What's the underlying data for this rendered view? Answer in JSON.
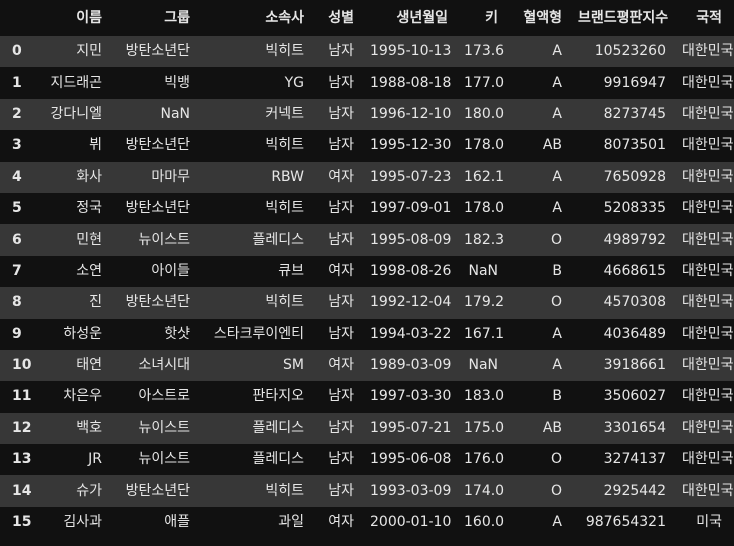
{
  "table": {
    "columns": [
      "",
      "이름",
      "그룹",
      "소속사",
      "성별",
      "생년월일",
      "키",
      "혈액형",
      "브랜드평판지수",
      "국적"
    ],
    "rows": [
      [
        "0",
        "지민",
        "방탄소년단",
        "빅히트",
        "남자",
        "1995-10-13",
        "173.6",
        "A",
        "10523260",
        "대한민국"
      ],
      [
        "1",
        "지드래곤",
        "빅뱅",
        "YG",
        "남자",
        "1988-08-18",
        "177.0",
        "A",
        "9916947",
        "대한민국"
      ],
      [
        "2",
        "강다니엘",
        "NaN",
        "커넥트",
        "남자",
        "1996-12-10",
        "180.0",
        "A",
        "8273745",
        "대한민국"
      ],
      [
        "3",
        "뷔",
        "방탄소년단",
        "빅히트",
        "남자",
        "1995-12-30",
        "178.0",
        "AB",
        "8073501",
        "대한민국"
      ],
      [
        "4",
        "화사",
        "마마무",
        "RBW",
        "여자",
        "1995-07-23",
        "162.1",
        "A",
        "7650928",
        "대한민국"
      ],
      [
        "5",
        "정국",
        "방탄소년단",
        "빅히트",
        "남자",
        "1997-09-01",
        "178.0",
        "A",
        "5208335",
        "대한민국"
      ],
      [
        "6",
        "민현",
        "뉴이스트",
        "플레디스",
        "남자",
        "1995-08-09",
        "182.3",
        "O",
        "4989792",
        "대한민국"
      ],
      [
        "7",
        "소연",
        "아이들",
        "큐브",
        "여자",
        "1998-08-26",
        "NaN",
        "B",
        "4668615",
        "대한민국"
      ],
      [
        "8",
        "진",
        "방탄소년단",
        "빅히트",
        "남자",
        "1992-12-04",
        "179.2",
        "O",
        "4570308",
        "대한민국"
      ],
      [
        "9",
        "하성운",
        "핫샷",
        "스타크루이엔티",
        "남자",
        "1994-03-22",
        "167.1",
        "A",
        "4036489",
        "대한민국"
      ],
      [
        "10",
        "태연",
        "소녀시대",
        "SM",
        "여자",
        "1989-03-09",
        "NaN",
        "A",
        "3918661",
        "대한민국"
      ],
      [
        "11",
        "차은우",
        "아스트로",
        "판타지오",
        "남자",
        "1997-03-30",
        "183.0",
        "B",
        "3506027",
        "대한민국"
      ],
      [
        "12",
        "백호",
        "뉴이스트",
        "플레디스",
        "남자",
        "1995-07-21",
        "175.0",
        "AB",
        "3301654",
        "대한민국"
      ],
      [
        "13",
        "JR",
        "뉴이스트",
        "플레디스",
        "남자",
        "1995-06-08",
        "176.0",
        "O",
        "3274137",
        "대한민국"
      ],
      [
        "14",
        "슈가",
        "방탄소년단",
        "빅히트",
        "남자",
        "1993-03-09",
        "174.0",
        "O",
        "2925442",
        "대한민국"
      ],
      [
        "15",
        "김사과",
        "애플",
        "과일",
        "여자",
        "2000-01-10",
        "160.0",
        "A",
        "987654321",
        "미국"
      ]
    ]
  }
}
